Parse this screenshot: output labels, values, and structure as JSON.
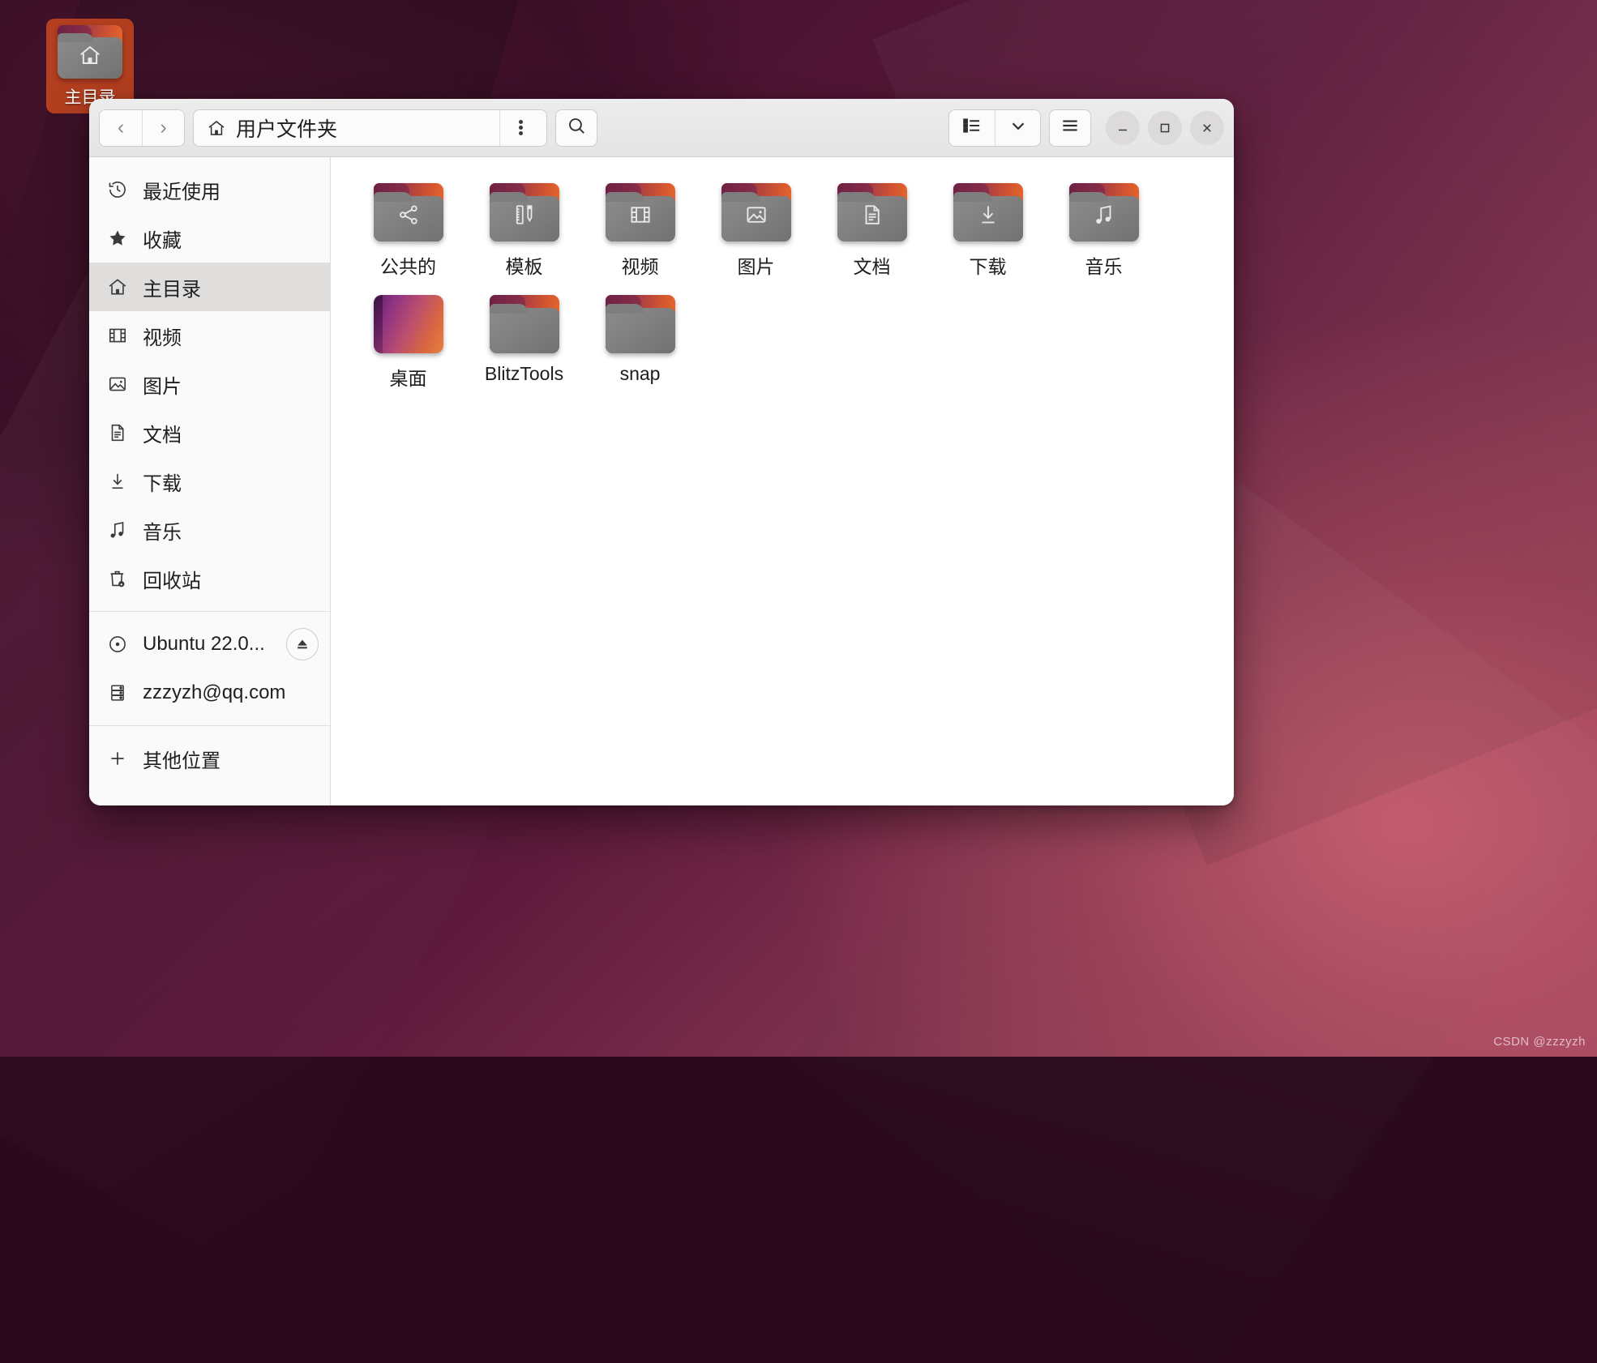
{
  "desktop": {
    "icon": {
      "label": "主目录",
      "icon": "home-folder-icon"
    },
    "watermark": "CSDN @zzzyzh",
    "accent_color": "#e8803f",
    "wallpaper_colors": [
      "#3a0f28",
      "#5e1a3c",
      "#b0566c"
    ]
  },
  "window": {
    "header": {
      "back_label": "‹",
      "forward_label": "›",
      "path_text": "用户文件夹",
      "path_icon": "home-icon",
      "kebab_icon": "three-dots-vertical-icon",
      "search_icon": "search-icon",
      "view_list_icon": "list-view-icon",
      "view_dropdown_icon": "chevron-down-icon",
      "menu_icon": "hamburger-menu-icon",
      "minimize_label": "—",
      "maximize_label": "□",
      "close_label": "✕"
    },
    "sidebar": {
      "items": [
        {
          "label": "最近使用",
          "icon": "recent-clock-icon",
          "selected": false
        },
        {
          "label": "收藏",
          "icon": "star-icon",
          "selected": false
        },
        {
          "label": "主目录",
          "icon": "home-icon",
          "selected": true
        },
        {
          "label": "视频",
          "icon": "film-icon",
          "selected": false
        },
        {
          "label": "图片",
          "icon": "image-icon",
          "selected": false
        },
        {
          "label": "文档",
          "icon": "document-icon",
          "selected": false
        },
        {
          "label": "下载",
          "icon": "download-arrow-icon",
          "selected": false
        },
        {
          "label": "音乐",
          "icon": "music-note-icon",
          "selected": false
        },
        {
          "label": "回收站",
          "icon": "trash-icon",
          "selected": false
        }
      ],
      "devices": [
        {
          "label": "Ubuntu 22.0...",
          "icon": "disc-icon",
          "eject": true,
          "eject_icon": "eject-icon"
        },
        {
          "label": "zzzyzh@qq.com",
          "icon": "server-icon",
          "eject": false
        }
      ],
      "other_locations": {
        "label": "其他位置",
        "icon": "plus-icon"
      }
    },
    "content": {
      "files": [
        {
          "name": "公共的",
          "type": "folder",
          "glyph": "share-icon"
        },
        {
          "name": "模板",
          "type": "folder",
          "glyph": "template-ruler-icon"
        },
        {
          "name": "视频",
          "type": "folder",
          "glyph": "film-icon"
        },
        {
          "name": "图片",
          "type": "folder",
          "glyph": "image-icon"
        },
        {
          "name": "文档",
          "type": "folder",
          "glyph": "document-icon"
        },
        {
          "name": "下载",
          "type": "folder",
          "glyph": "download-arrow-icon"
        },
        {
          "name": "音乐",
          "type": "folder",
          "glyph": "music-note-icon"
        },
        {
          "name": "桌面",
          "type": "picture-folder",
          "glyph": ""
        },
        {
          "name": "BlitzTools",
          "type": "folder",
          "glyph": ""
        },
        {
          "name": "snap",
          "type": "folder",
          "glyph": ""
        }
      ]
    }
  }
}
